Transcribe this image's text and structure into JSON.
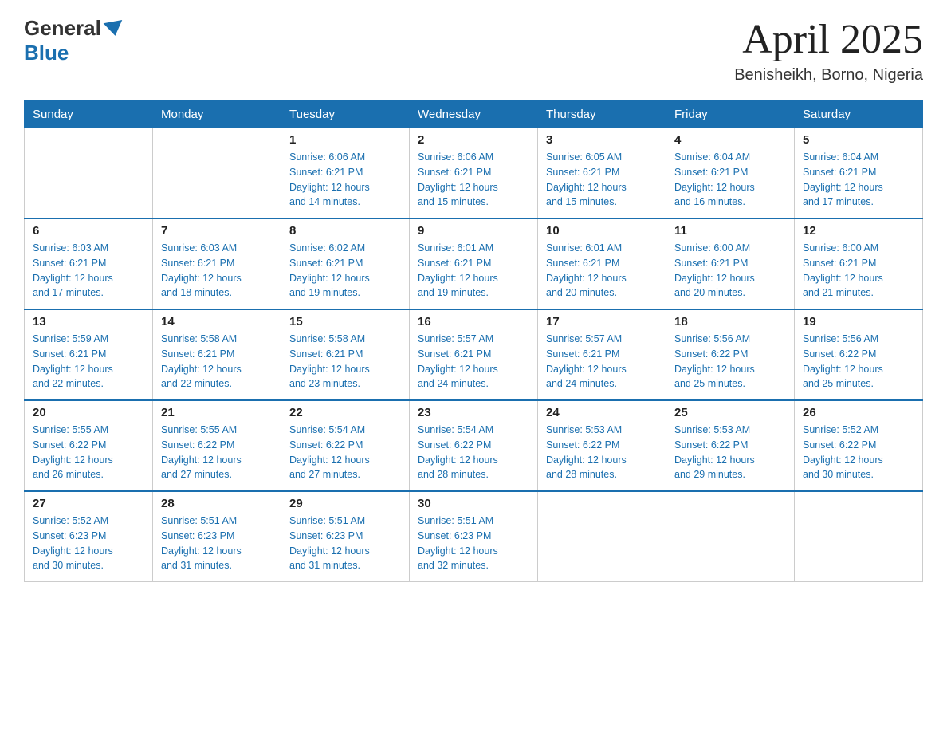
{
  "header": {
    "logo_general": "General",
    "logo_blue": "Blue",
    "month_title": "April 2025",
    "location": "Benisheikh, Borno, Nigeria"
  },
  "days_of_week": [
    "Sunday",
    "Monday",
    "Tuesday",
    "Wednesday",
    "Thursday",
    "Friday",
    "Saturday"
  ],
  "weeks": [
    [
      {
        "day": "",
        "info": ""
      },
      {
        "day": "",
        "info": ""
      },
      {
        "day": "1",
        "info": "Sunrise: 6:06 AM\nSunset: 6:21 PM\nDaylight: 12 hours\nand 14 minutes."
      },
      {
        "day": "2",
        "info": "Sunrise: 6:06 AM\nSunset: 6:21 PM\nDaylight: 12 hours\nand 15 minutes."
      },
      {
        "day": "3",
        "info": "Sunrise: 6:05 AM\nSunset: 6:21 PM\nDaylight: 12 hours\nand 15 minutes."
      },
      {
        "day": "4",
        "info": "Sunrise: 6:04 AM\nSunset: 6:21 PM\nDaylight: 12 hours\nand 16 minutes."
      },
      {
        "day": "5",
        "info": "Sunrise: 6:04 AM\nSunset: 6:21 PM\nDaylight: 12 hours\nand 17 minutes."
      }
    ],
    [
      {
        "day": "6",
        "info": "Sunrise: 6:03 AM\nSunset: 6:21 PM\nDaylight: 12 hours\nand 17 minutes."
      },
      {
        "day": "7",
        "info": "Sunrise: 6:03 AM\nSunset: 6:21 PM\nDaylight: 12 hours\nand 18 minutes."
      },
      {
        "day": "8",
        "info": "Sunrise: 6:02 AM\nSunset: 6:21 PM\nDaylight: 12 hours\nand 19 minutes."
      },
      {
        "day": "9",
        "info": "Sunrise: 6:01 AM\nSunset: 6:21 PM\nDaylight: 12 hours\nand 19 minutes."
      },
      {
        "day": "10",
        "info": "Sunrise: 6:01 AM\nSunset: 6:21 PM\nDaylight: 12 hours\nand 20 minutes."
      },
      {
        "day": "11",
        "info": "Sunrise: 6:00 AM\nSunset: 6:21 PM\nDaylight: 12 hours\nand 20 minutes."
      },
      {
        "day": "12",
        "info": "Sunrise: 6:00 AM\nSunset: 6:21 PM\nDaylight: 12 hours\nand 21 minutes."
      }
    ],
    [
      {
        "day": "13",
        "info": "Sunrise: 5:59 AM\nSunset: 6:21 PM\nDaylight: 12 hours\nand 22 minutes."
      },
      {
        "day": "14",
        "info": "Sunrise: 5:58 AM\nSunset: 6:21 PM\nDaylight: 12 hours\nand 22 minutes."
      },
      {
        "day": "15",
        "info": "Sunrise: 5:58 AM\nSunset: 6:21 PM\nDaylight: 12 hours\nand 23 minutes."
      },
      {
        "day": "16",
        "info": "Sunrise: 5:57 AM\nSunset: 6:21 PM\nDaylight: 12 hours\nand 24 minutes."
      },
      {
        "day": "17",
        "info": "Sunrise: 5:57 AM\nSunset: 6:21 PM\nDaylight: 12 hours\nand 24 minutes."
      },
      {
        "day": "18",
        "info": "Sunrise: 5:56 AM\nSunset: 6:22 PM\nDaylight: 12 hours\nand 25 minutes."
      },
      {
        "day": "19",
        "info": "Sunrise: 5:56 AM\nSunset: 6:22 PM\nDaylight: 12 hours\nand 25 minutes."
      }
    ],
    [
      {
        "day": "20",
        "info": "Sunrise: 5:55 AM\nSunset: 6:22 PM\nDaylight: 12 hours\nand 26 minutes."
      },
      {
        "day": "21",
        "info": "Sunrise: 5:55 AM\nSunset: 6:22 PM\nDaylight: 12 hours\nand 27 minutes."
      },
      {
        "day": "22",
        "info": "Sunrise: 5:54 AM\nSunset: 6:22 PM\nDaylight: 12 hours\nand 27 minutes."
      },
      {
        "day": "23",
        "info": "Sunrise: 5:54 AM\nSunset: 6:22 PM\nDaylight: 12 hours\nand 28 minutes."
      },
      {
        "day": "24",
        "info": "Sunrise: 5:53 AM\nSunset: 6:22 PM\nDaylight: 12 hours\nand 28 minutes."
      },
      {
        "day": "25",
        "info": "Sunrise: 5:53 AM\nSunset: 6:22 PM\nDaylight: 12 hours\nand 29 minutes."
      },
      {
        "day": "26",
        "info": "Sunrise: 5:52 AM\nSunset: 6:22 PM\nDaylight: 12 hours\nand 30 minutes."
      }
    ],
    [
      {
        "day": "27",
        "info": "Sunrise: 5:52 AM\nSunset: 6:23 PM\nDaylight: 12 hours\nand 30 minutes."
      },
      {
        "day": "28",
        "info": "Sunrise: 5:51 AM\nSunset: 6:23 PM\nDaylight: 12 hours\nand 31 minutes."
      },
      {
        "day": "29",
        "info": "Sunrise: 5:51 AM\nSunset: 6:23 PM\nDaylight: 12 hours\nand 31 minutes."
      },
      {
        "day": "30",
        "info": "Sunrise: 5:51 AM\nSunset: 6:23 PM\nDaylight: 12 hours\nand 32 minutes."
      },
      {
        "day": "",
        "info": ""
      },
      {
        "day": "",
        "info": ""
      },
      {
        "day": "",
        "info": ""
      }
    ]
  ]
}
